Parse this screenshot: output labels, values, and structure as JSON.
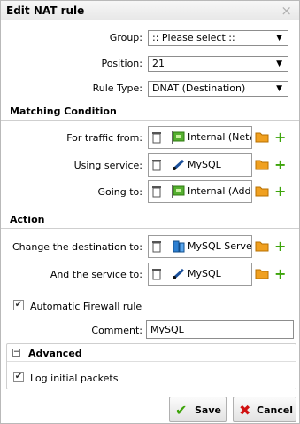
{
  "window": {
    "title": "Edit NAT rule",
    "close_glyph": "×"
  },
  "form": {
    "group": {
      "label": "Group:",
      "value": ":: Please select ::"
    },
    "position": {
      "label": "Position:",
      "value": "21"
    },
    "rule_type": {
      "label": "Rule Type:",
      "value": "DNAT (Destination)"
    }
  },
  "matching": {
    "heading": "Matching Condition",
    "traffic_from": {
      "label": "For traffic from:",
      "value": "Internal (Netw",
      "icon": "network-icon"
    },
    "service": {
      "label": "Using service:",
      "value": "MySQL",
      "icon": "service-icon"
    },
    "going_to": {
      "label": "Going to:",
      "value": "Internal (Addr",
      "icon": "network-icon"
    }
  },
  "action": {
    "heading": "Action",
    "change_dest": {
      "label": "Change the destination to:",
      "value": "MySQL Serve",
      "icon": "server-icon"
    },
    "service_to": {
      "label": "And the service to:",
      "value": "MySQL",
      "icon": "service-icon"
    }
  },
  "automatic_rule": {
    "label": "Automatic Firewall rule",
    "checked": true
  },
  "comment": {
    "label": "Comment:",
    "value": "MySQL"
  },
  "advanced": {
    "heading": "Advanced",
    "log_packets": {
      "label": "Log initial packets",
      "checked": true
    }
  },
  "buttons": {
    "save": "Save",
    "cancel": "Cancel"
  },
  "colors": {
    "green": "#3da40a",
    "red": "#d01010",
    "folder": "#f0a020"
  }
}
